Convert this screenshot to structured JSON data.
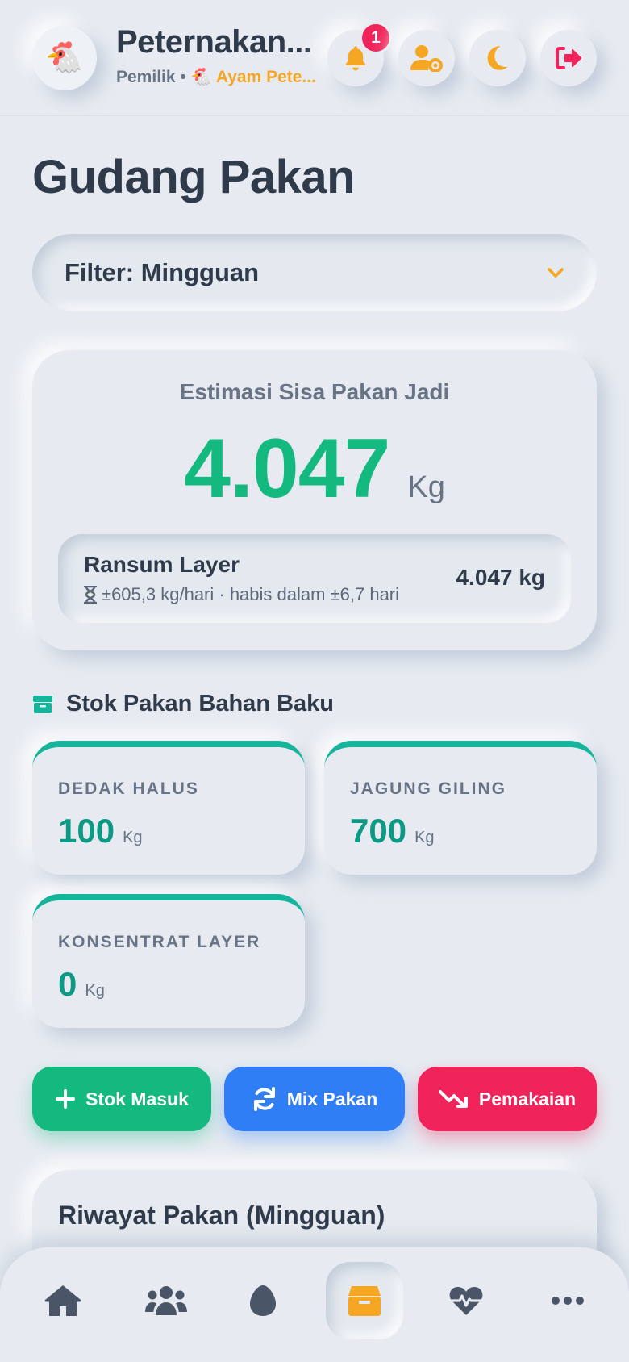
{
  "header": {
    "logo_emoji": "🐔",
    "farm_name": "Peternakan...",
    "role": "Pemilik",
    "separator": "•",
    "type_emoji": "🐔",
    "farm_type": "Ayam Pete...",
    "notification_count": "1",
    "icons": [
      "bell-icon",
      "user-gear-icon",
      "moon-icon",
      "logout-icon"
    ],
    "accent_color": "#f5a623",
    "logout_color": "#f0245a"
  },
  "page": {
    "title": "Gudang Pakan"
  },
  "filter": {
    "label": "Filter: Mingguan"
  },
  "estimate": {
    "title": "Estimasi Sisa Pakan Jadi",
    "value": "4.047",
    "unit": "Kg",
    "value_color": "#13b97e",
    "ransum": {
      "name": "Ransum Layer",
      "info": "±605,3 kg/hari · habis dalam ±6,7 hari",
      "qty": "4.047 kg"
    }
  },
  "stock_section": {
    "title": "Stok Pakan Bahan Baku",
    "items": [
      {
        "label": "DEDAK HALUS",
        "value": "100",
        "unit": "Kg"
      },
      {
        "label": "JAGUNG GILING",
        "value": "700",
        "unit": "Kg"
      },
      {
        "label": "KONSENTRAT LAYER",
        "value": "0",
        "unit": "Kg"
      }
    ]
  },
  "actions": {
    "stock_in": "Stok Masuk",
    "mix": "Mix Pakan",
    "usage": "Pemakaian"
  },
  "history": {
    "title": "Riwayat Pakan (Mingguan)"
  },
  "bottom_nav": {
    "items": [
      "home-icon",
      "users-icon",
      "egg-icon",
      "box-icon",
      "heartbeat-icon",
      "more-icon"
    ],
    "active": "box-icon"
  }
}
